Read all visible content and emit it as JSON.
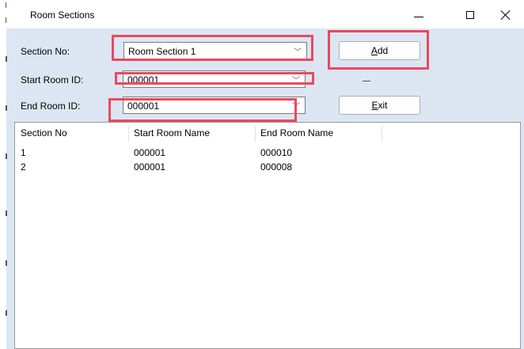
{
  "window": {
    "title": "Room Sections"
  },
  "form": {
    "section_no_label": "Section No:",
    "section_no_value": "Room Section 1",
    "start_room_label": "Start Room ID:",
    "start_room_value": "000001",
    "end_room_label": "End Room ID:",
    "end_room_value": "000001",
    "dash_text": "—"
  },
  "buttons": {
    "add_hotkey": "A",
    "add_rest": "dd",
    "exit_hotkey": "E",
    "exit_rest": "xit"
  },
  "table": {
    "headers": [
      "Section No",
      "Start Room Name",
      "End Room Name"
    ],
    "rows": [
      [
        "1",
        "000001",
        "000010"
      ],
      [
        "2",
        "000001",
        "000008"
      ]
    ]
  },
  "colors": {
    "highlight": "#e84a5f",
    "window_bg": "#dce6f3"
  },
  "icons": [
    "minimize-icon",
    "maximize-icon",
    "close-icon",
    "dropdown-arrow-icon"
  ]
}
